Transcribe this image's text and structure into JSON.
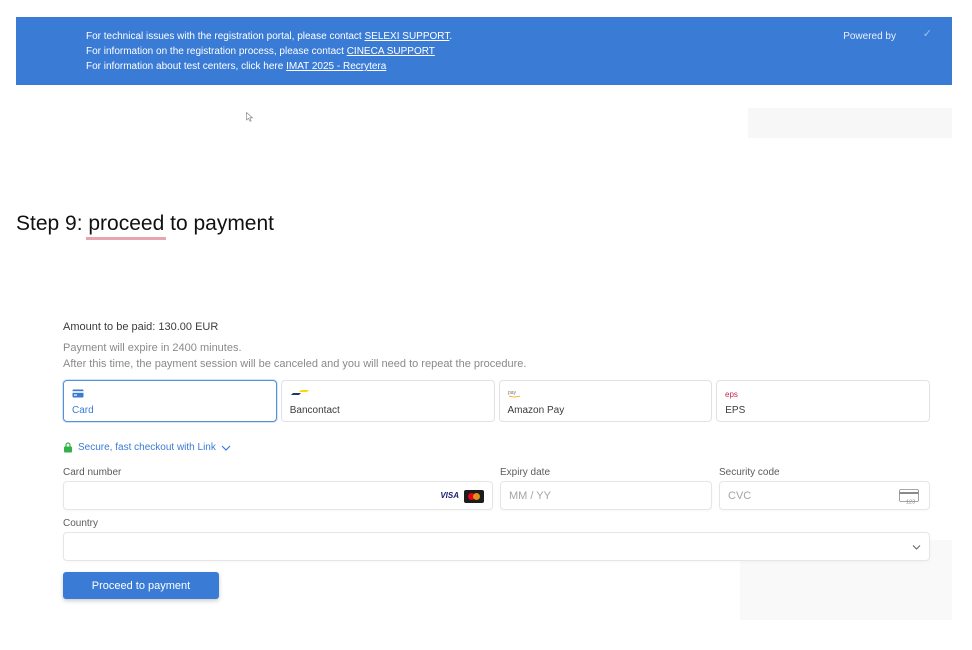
{
  "banner": {
    "line1_prefix": "For technical issues with the registration portal, please contact ",
    "line1_link": "SELEXI SUPPORT",
    "line1_suffix": ".",
    "line2_prefix": "For information on the registration process, please contact ",
    "line2_link": "CINECA SUPPORT",
    "line3_prefix": "For information about test centers, click here ",
    "line3_link": "IMAT 2025 - Recrytera",
    "powered_by": "Powered by"
  },
  "step": {
    "heading": "Step 9: proceed to payment"
  },
  "payment": {
    "amount": "Amount to be paid: 130.00 EUR",
    "expire_line1": "Payment will expire in 2400 minutes.",
    "expire_line2": "After this time, the payment session will be canceled and you will need to repeat the procedure.",
    "methods": [
      {
        "label": "Card",
        "icon": "card-icon"
      },
      {
        "label": "Bancontact",
        "icon": "bancontact-icon"
      },
      {
        "label": "Amazon Pay",
        "icon": "amazon-pay-icon"
      },
      {
        "label": "EPS",
        "icon": "eps-icon"
      }
    ],
    "link_text": "Secure, fast checkout with Link",
    "card_number_label": "Card number",
    "expiry_label": "Expiry date",
    "expiry_placeholder": "MM / YY",
    "security_label": "Security code",
    "security_placeholder": "CVC",
    "cvc_icon_text": "123",
    "visa_text": "VISA",
    "country_label": "Country",
    "country_value": "",
    "button": "Proceed to payment"
  },
  "colors": {
    "accent": "#3a7bd5",
    "underline": "#e8a5b0"
  }
}
